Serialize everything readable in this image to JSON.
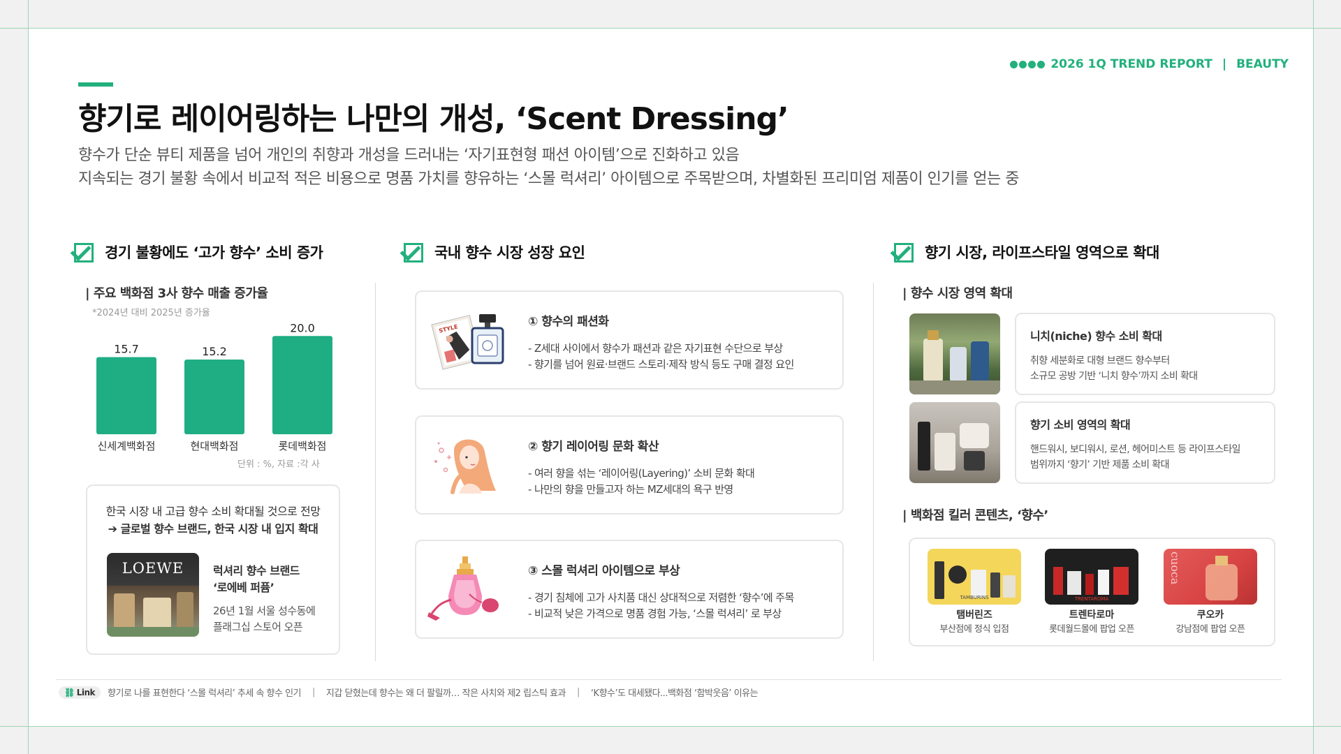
{
  "report": {
    "label": "2026 1Q TREND REPORT",
    "category": "BEAUTY",
    "accent": "#22b07d"
  },
  "title": "향기로 레이어링하는 나만의 개성, ‘Scent Dressing’",
  "subtitle": [
    "향수가 단순 뷰티 제품을 넘어 개인의 취향과 개성을 드러내는 ‘자기표현형 패션 아이템’으로 진화하고 있음",
    "지속되는 경기 불황 속에서 비교적 적은 비용으로 명품 가치를 향유하는 ‘스몰 럭셔리’ 아이템으로 주목받으며, 차별화된 프리미엄 제품이 인기를 얻는 중"
  ],
  "left": {
    "heading": "경기 불황에도 ‘고가 향수’ 소비 증가",
    "sub_label": "| 주요 백화점 3사 향수 매출 증가율",
    "note": "*2024년 대비 2025년 증가율",
    "source": "단위 : %, 자료 :각 사",
    "forecast": {
      "line1": "한국 시장 내 고급 향수 소비 확대될 것으로 전망",
      "line2": "➔ 글로벌 향수 브랜드, 한국 시장 내 입지 확대"
    },
    "brand_card": {
      "logo": "LOEWE",
      "title_line1": "럭셔리 향수 브랜드",
      "title_line2": "‘로에베 퍼퓸’",
      "desc_line1": "26년 1월 서울 성수동에",
      "desc_line2": "플래그십 스토어 오픈"
    }
  },
  "chart_data": {
    "type": "bar",
    "categories": [
      "신세계백화점",
      "현대백화점",
      "롯데백화점"
    ],
    "values": [
      15.7,
      15.2,
      20.0
    ],
    "value_labels": [
      "15.7",
      "15.2",
      "20.0"
    ],
    "ylim": [
      0,
      22
    ],
    "color": "#1fad84",
    "grid": false
  },
  "middle": {
    "heading": "국내 향수 시장 성장 요인",
    "factors": [
      {
        "title": "① 향수의 패션화",
        "lines": [
          "- Z세대 사이에서 향수가 패션과 같은 자기표현 수단으로 부상",
          "- 향기를 넘어 원료·브랜드 스토리·제작 방식 등도 구매 결정 요인"
        ],
        "icon": "magazine-perfume-icon"
      },
      {
        "title": "② 향기 레이어링 문화 확산",
        "lines": [
          "- 여러 향을 섞는 ‘레이어링(Layering)’ 소비 문화 확대",
          "- 나만의 향을 만들고자 하는 MZ세대의 욕구 반영"
        ],
        "icon": "woman-scent-icon"
      },
      {
        "title": "③ 스몰 럭셔리 아이템으로 부상",
        "lines": [
          "- 경기 침체에 고가 사치품 대신 상대적으로 저렴한 ‘향수’에 주목",
          "- 비교적 낮은 가격으로 명품 경험 가능, ‘스몰 럭셔리’ 로 부상"
        ],
        "icon": "atomizer-icon"
      }
    ]
  },
  "right": {
    "heading": "향기 시장, 라이프스타일 영역으로 확대",
    "sub_label_1": "| 향수 시장 영역 확대",
    "markets": [
      {
        "title": "니치(niche) 향수 소비 확대",
        "lines": [
          "취향 세분화로 대형 브랜드 향수부터",
          "소규모 공방 기반 ‘니치 향수’까지 소비 확대"
        ]
      },
      {
        "title": "향기 소비 영역의 확대",
        "lines": [
          "핸드워시, 보디워시, 로션, 헤어미스트 등 라이프스타일",
          "범위까지 ‘향기’ 기반 제품 소비 확대"
        ]
      }
    ],
    "sub_label_2": "| 백화점 킬러 콘텐츠, ‘향수’",
    "brands": [
      {
        "name": "탬버린즈",
        "where": "부산점에 정식 입점",
        "img_text": "TAMBURINS"
      },
      {
        "name": "트렌타로마",
        "where": "롯데월드몰에 팝업 오픈",
        "img_text": "TRENTAROMA"
      },
      {
        "name": "쿠오카",
        "where": "강남점에 팝업 오픈",
        "img_text": "cuoca"
      }
    ]
  },
  "footer": {
    "badge": "Link",
    "links": [
      "향기로 나를 표현한다 ‘스몰 럭셔리’ 추세 속 향수 인기",
      "지갑 닫혔는데 향수는 왜 더 팔릴까… 작은 사치와 제2 립스틱 효과",
      "‘K향수’도 대세됐다...백화점 ‘함박웃음’ 이유는"
    ]
  }
}
